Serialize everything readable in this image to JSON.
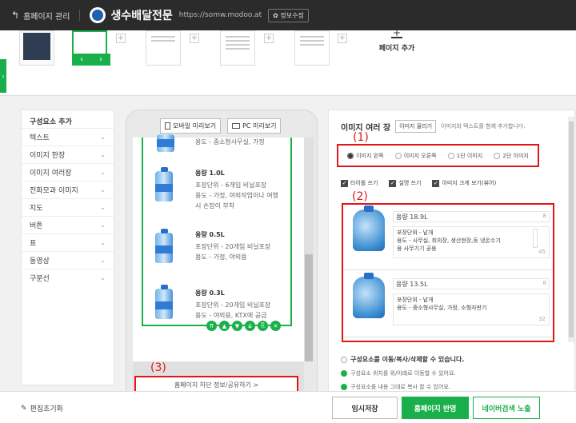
{
  "header": {
    "back_label": "홈페이지 관리",
    "site_title": "생수배달전문",
    "url": "https://somw.modoo.at",
    "info_button": "정보수정"
  },
  "pages": {
    "add_label": "페이지 추가"
  },
  "components": {
    "heading": "구성요소 추가",
    "items": [
      "텍스트",
      "이미지 한장",
      "이미지 여러장",
      "전화모과 이미지",
      "지도",
      "버튼",
      "표",
      "동영상",
      "구분선"
    ]
  },
  "preview": {
    "mobile_label": "모바일 미리보기",
    "pc_label": "PC 미리보기",
    "products": [
      {
        "title": "",
        "lines": [
          "용도 - 중소형사무실, 가정"
        ]
      },
      {
        "title": "용량 1.0L",
        "lines": [
          "포장단위 - 6개입 비닐포장",
          "용도 - 가정, 야외작업이나 여행",
          "시 손잡이 부착"
        ]
      },
      {
        "title": "용량 0.5L",
        "lines": [
          "포장단위 - 20개입 비닐포장",
          "용도 - 가정, 야외용"
        ]
      },
      {
        "title": "용량 0.3L",
        "lines": [
          "포장단위 - 20개입 비닐포장",
          "용도 - 야외용, KTX에 공급"
        ]
      }
    ],
    "footer_link": "홈페이지 하단 정보/공유하기 >",
    "annotation_3": "(3)"
  },
  "editor": {
    "title": "이미지 여러 장",
    "swap_label": "이미지 올리기",
    "description": "이미지와 텍스트를 함께 추가합니다.",
    "annotation_1": "(1)",
    "annotation_2": "(2)",
    "layout_options": [
      "이미지 왼쪽",
      "이미지 오른쪽",
      "1단 이미지",
      "2단 이미지"
    ],
    "checks": [
      "타이틀 쓰기",
      "설명 쓰기",
      "이미지 크게 보기(뷰어)"
    ],
    "items": [
      {
        "name": "용량 18.9L",
        "name_count": "8",
        "desc_lines": [
          "포장단위 - 낱개",
          "용도 - 사무실, 회의장, 생산현장,등 냉온수기",
          "용 사무기기 공용"
        ],
        "desc_count": "45"
      },
      {
        "name": "용량 13.5L",
        "name_count": "8",
        "desc_lines": [
          "포장단위 - 낱개",
          "용도 - 중소형사무실, 가정, 소형자판기"
        ],
        "desc_count": "32"
      }
    ],
    "notes_head": "구성요소를 이동/복사/삭제할 수 있습니다.",
    "notes": [
      "구성요소 위치를 위/아래로 이동할 수 있어요.",
      "구성요소를 내용 그대로 복사 할 수 있어요."
    ]
  },
  "bottom": {
    "reset_label": "편집초기화",
    "temp_save": "임시저장",
    "apply": "홈페이지 반영",
    "naver": "네이버검색 노출"
  }
}
